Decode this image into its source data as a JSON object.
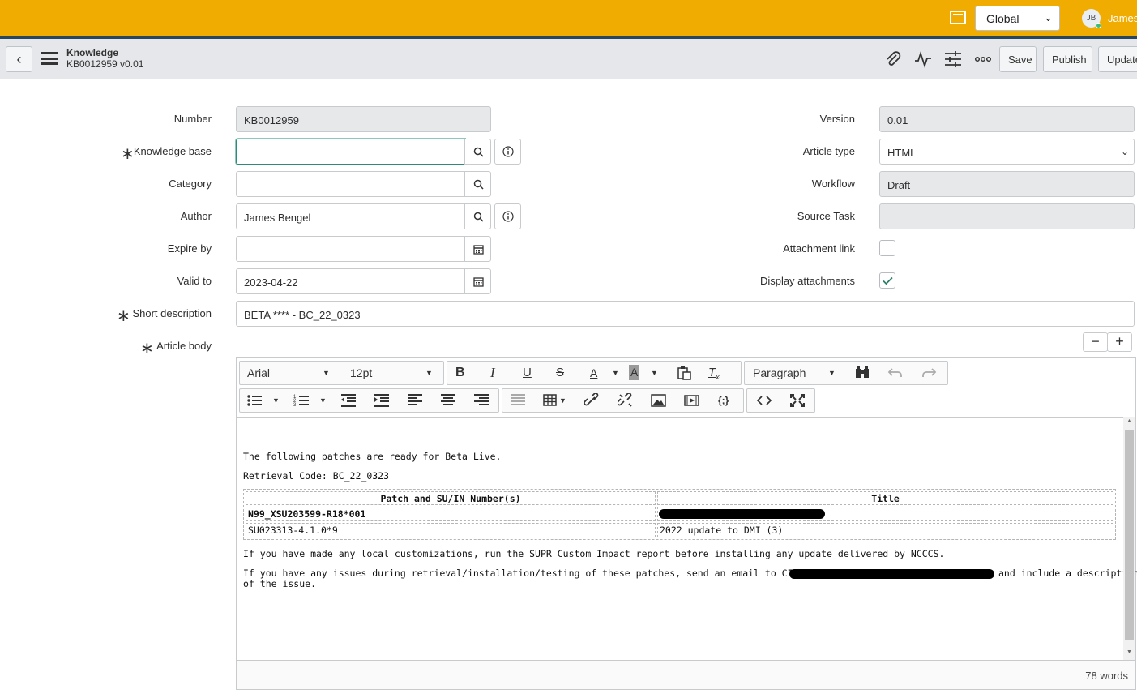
{
  "banner": {
    "scope_value": "Global",
    "avatar_initials": "JB",
    "user_name": "James"
  },
  "header": {
    "title": "Knowledge",
    "subtitle": "KB0012959 v0.01",
    "buttons": {
      "save": "Save",
      "publish": "Publish",
      "update": "Update"
    }
  },
  "form": {
    "number": {
      "label": "Number",
      "value": "KB0012959"
    },
    "knowledge_base": {
      "label": "Knowledge base",
      "value": ""
    },
    "category": {
      "label": "Category",
      "value": ""
    },
    "author": {
      "label": "Author",
      "value": "James Bengel"
    },
    "expire_by": {
      "label": "Expire by",
      "value": ""
    },
    "valid_to": {
      "label": "Valid to",
      "value": "2023-04-22"
    },
    "short_description": {
      "label": "Short description",
      "value": "BETA **** - BC_22_0323"
    },
    "article_body": {
      "label": "Article body"
    },
    "version": {
      "label": "Version",
      "value": "0.01"
    },
    "article_type": {
      "label": "Article type",
      "value": "HTML"
    },
    "workflow": {
      "label": "Workflow",
      "value": "Draft"
    },
    "source_task": {
      "label": "Source Task",
      "value": ""
    },
    "attachment_link": {
      "label": "Attachment link",
      "checked": false
    },
    "display_attachments": {
      "label": "Display attachments",
      "checked": true
    }
  },
  "editor": {
    "font_family": "Arial",
    "font_size": "12pt",
    "block_format": "Paragraph",
    "content": {
      "line1": "The following patches are ready for Beta Live.",
      "line2": "Retrieval Code: BC_22_0323",
      "table_headers": [
        "Patch and SU/IN Number(s)",
        "Title"
      ],
      "table_rows": [
        [
          "N99_XSU203599-R18*001",
          ""
        ],
        [
          "SU023313-4.1.0*9",
          "2022 update to DMI (3)"
        ]
      ],
      "line3": "If you have made any local customizations, run the SUPR Custom Impact report before installing any update delivered by NCCCS.",
      "line4a": "If you have any issues during retrieval/installation/testing of these patches, send an email to CIS Release Management a",
      "line4b": "and include a description",
      "line5": "of the issue."
    },
    "word_count": "78 words"
  }
}
